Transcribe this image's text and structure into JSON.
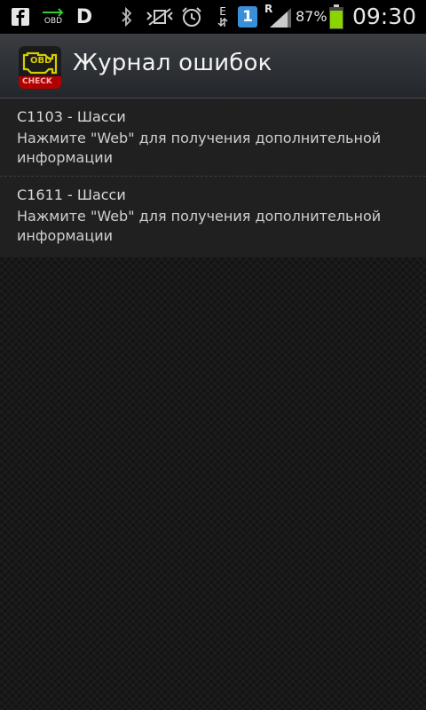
{
  "status_bar": {
    "battery_text": "87%",
    "time": "09:30",
    "network_letter": "E",
    "roaming_letter": "R",
    "notification_count": "1",
    "obd_label": "OBD",
    "d_label": "D",
    "battery_color": "#8bd400",
    "icons": [
      "facebook-icon",
      "obd-icon",
      "d-icon",
      "bluetooth-icon",
      "mute-icon",
      "alarm-icon",
      "data-e-icon",
      "notification-1-icon",
      "signal-icon",
      "battery-icon"
    ]
  },
  "app_bar": {
    "title": "Журнал ошибок",
    "icon_top": "OBD",
    "icon_bottom": "CHECK",
    "icon_label_color": "#d0d000"
  },
  "errors": [
    {
      "code": "C1103 - Шасси",
      "description": "Нажмите \"Web\" для получения дополнительной информации"
    },
    {
      "code": "C1611 - Шасси",
      "description": "Нажмите \"Web\" для получения дополнительной информации"
    }
  ]
}
